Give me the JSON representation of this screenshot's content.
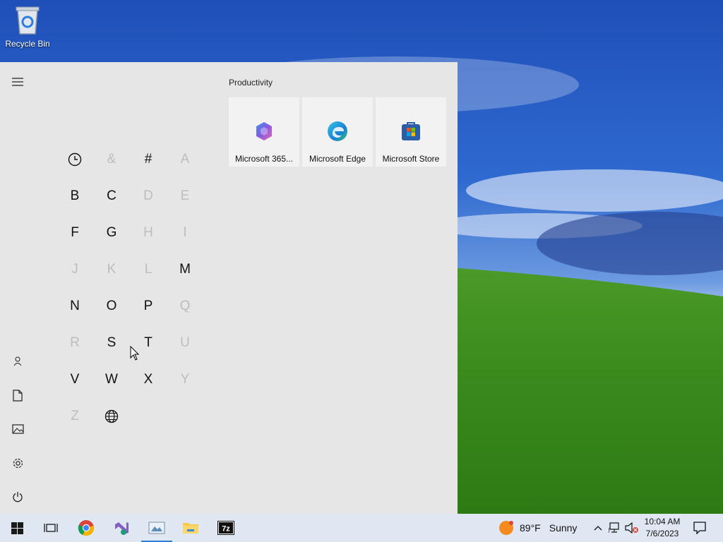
{
  "desktop": {
    "icons": [
      {
        "label": "Recycle Bin",
        "icon": "recycle-bin-icon"
      }
    ]
  },
  "start_menu": {
    "rail": [
      "hamburger-menu-icon",
      "user-icon",
      "document-icon",
      "pictures-icon",
      "settings-icon",
      "power-icon"
    ],
    "letter_grid": [
      {
        "label": "clock",
        "icon": "recent-clock-icon",
        "enabled": true
      },
      {
        "label": "&",
        "enabled": false
      },
      {
        "label": "#",
        "enabled": true
      },
      {
        "label": "A",
        "enabled": false
      },
      {
        "label": "B",
        "enabled": true
      },
      {
        "label": "C",
        "enabled": true
      },
      {
        "label": "D",
        "enabled": false
      },
      {
        "label": "E",
        "enabled": false
      },
      {
        "label": "F",
        "enabled": true
      },
      {
        "label": "G",
        "enabled": true
      },
      {
        "label": "H",
        "enabled": false
      },
      {
        "label": "I",
        "enabled": false
      },
      {
        "label": "J",
        "enabled": false
      },
      {
        "label": "K",
        "enabled": false
      },
      {
        "label": "L",
        "enabled": false
      },
      {
        "label": "M",
        "enabled": true
      },
      {
        "label": "N",
        "enabled": true
      },
      {
        "label": "O",
        "enabled": true
      },
      {
        "label": "P",
        "enabled": true
      },
      {
        "label": "Q",
        "enabled": false
      },
      {
        "label": "R",
        "enabled": false
      },
      {
        "label": "S",
        "enabled": true
      },
      {
        "label": "T",
        "enabled": true
      },
      {
        "label": "U",
        "enabled": false
      },
      {
        "label": "V",
        "enabled": true
      },
      {
        "label": "W",
        "enabled": true
      },
      {
        "label": "X",
        "enabled": true
      },
      {
        "label": "Y",
        "enabled": false
      },
      {
        "label": "Z",
        "enabled": false
      },
      {
        "label": "globe",
        "icon": "globe-icon",
        "enabled": true
      }
    ],
    "group": {
      "title": "Productivity",
      "tiles": [
        {
          "label": "Microsoft 365...",
          "icon": "microsoft-365-icon"
        },
        {
          "label": "Microsoft Edge",
          "icon": "edge-icon"
        },
        {
          "label": "Microsoft Store",
          "icon": "store-icon"
        }
      ]
    }
  },
  "taskbar": {
    "apps": [
      "start-icon",
      "task-view-icon",
      "chrome-icon",
      "visual-studio-icon",
      "snipping-tool-icon",
      "file-explorer-icon",
      "7zip-icon"
    ],
    "active_app": "snipping-tool-icon",
    "weather": {
      "temperature": "89°F",
      "condition": "Sunny",
      "icon": "sun-icon"
    },
    "tray": [
      "chevron-up-icon",
      "network-icon",
      "volume-muted-icon"
    ],
    "clock": {
      "time": "10:04 AM",
      "date": "7/6/2023"
    },
    "notification": "action-center-icon"
  },
  "colors": {
    "start_bg": "#e6e6e6",
    "taskbar_bg": "#dfe8f2",
    "accent": "#2f7ed8",
    "disabled_letter": "#bdbdbd"
  }
}
